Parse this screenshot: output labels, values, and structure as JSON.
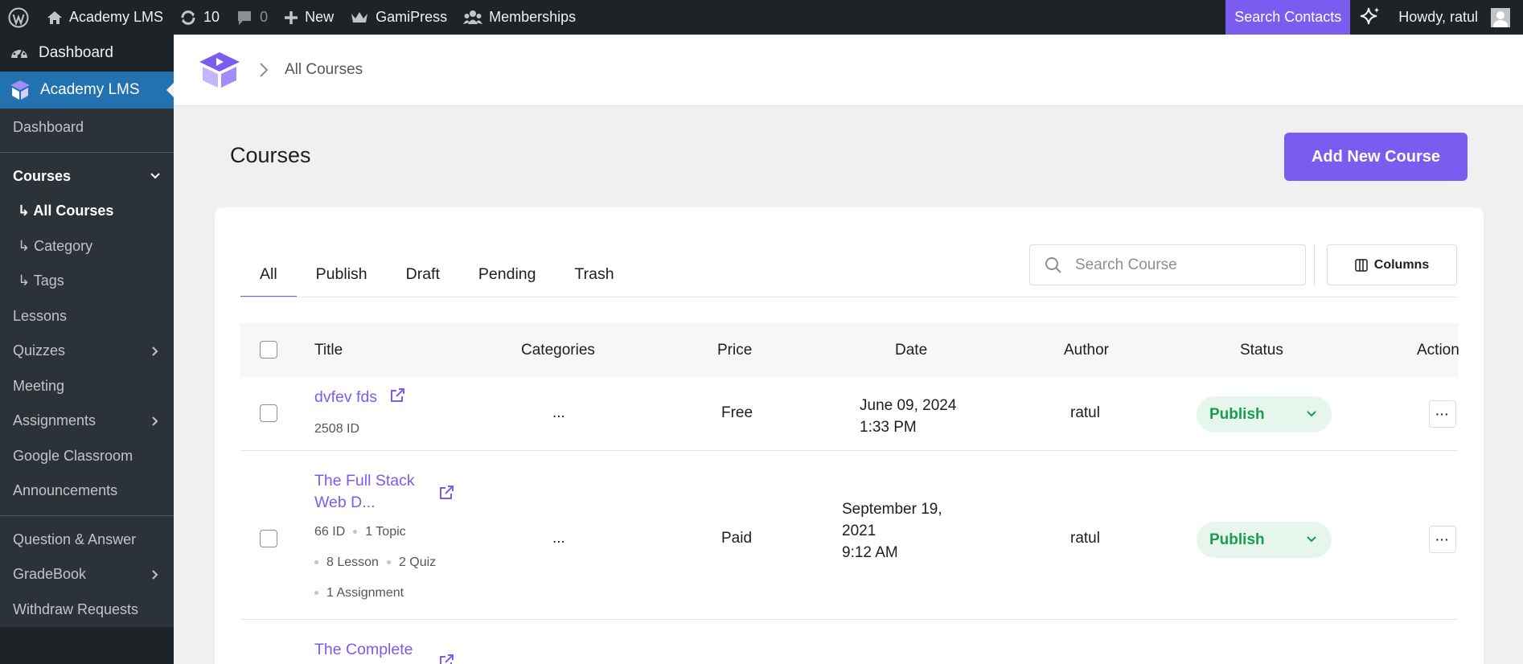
{
  "adminbar": {
    "site_name": "Academy LMS",
    "updates_count": "10",
    "comments_count": "0",
    "new_label": "New",
    "gamipress_label": "GamiPress",
    "memberships_label": "Memberships",
    "search_contacts_label": "Search Contacts",
    "howdy_label": "Howdy, ratul"
  },
  "sidebar": {
    "dashboard": "Dashboard",
    "academy": "Academy LMS",
    "items": {
      "dashboard": "Dashboard",
      "courses": "Courses",
      "all_courses": "↳ All Courses",
      "category": "↳ Category",
      "tags": "↳ Tags",
      "lessons": "Lessons",
      "quizzes": "Quizzes",
      "meeting": "Meeting",
      "assignments": "Assignments",
      "google_classroom": "Google Classroom",
      "announcements": "Announcements",
      "qa": "Question & Answer",
      "gradebook": "GradeBook",
      "withdraw": "Withdraw Requests"
    }
  },
  "breadcrumb": {
    "current": "All Courses"
  },
  "page": {
    "title": "Courses",
    "add_button": "Add New Course"
  },
  "tabs": [
    "All",
    "Publish",
    "Draft",
    "Pending",
    "Trash"
  ],
  "search": {
    "placeholder": "Search Course"
  },
  "columns_button": "Columns",
  "table": {
    "headers": {
      "title": "Title",
      "categories": "Categories",
      "price": "Price",
      "date": "Date",
      "author": "Author",
      "status": "Status",
      "action": "Action"
    },
    "rows": [
      {
        "title": "dvfev fds",
        "id": "2508 ID",
        "categories": "...",
        "price": "Free",
        "date_line1": "June 09, 2024",
        "date_line2": "1:33 PM",
        "author": "ratul",
        "status": "Publish",
        "action": "···"
      },
      {
        "title_line1": "The Full Stack",
        "title_line2": "Web D...",
        "id": "66 ID",
        "topic": "1 Topic",
        "lesson": "8 Lesson",
        "quiz": "2 Quiz",
        "assignment": "1 Assignment",
        "categories": "...",
        "price": "Paid",
        "date_line1": "September 19,",
        "date_line2": "2021",
        "date_line3": "9:12 AM",
        "author": "ratul",
        "status": "Publish",
        "action": "···"
      },
      {
        "title_line1": "The Complete"
      }
    ]
  },
  "colors": {
    "accent": "#7b5cf0",
    "adminbar": "#1d2327",
    "sidebar_active": "#2271b1",
    "status_green": "#1a9c4e"
  }
}
